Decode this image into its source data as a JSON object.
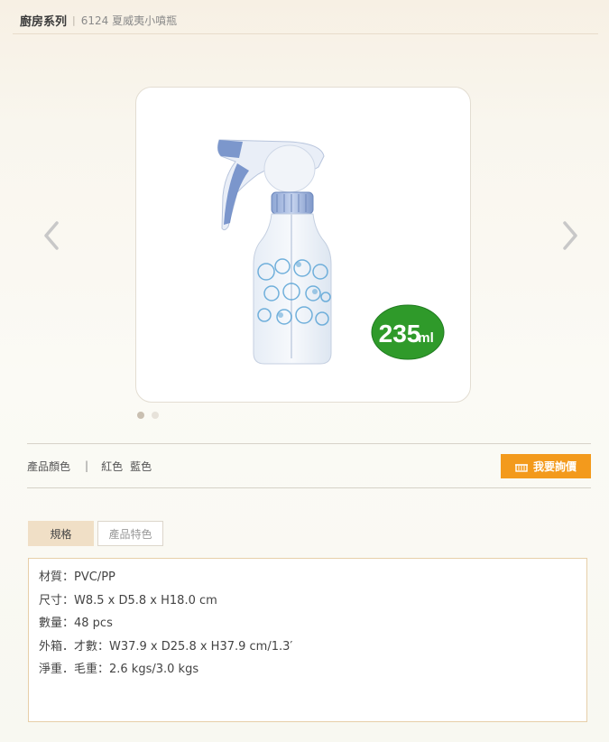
{
  "breadcrumb": {
    "category": "廚房系列",
    "separator": "|",
    "item": "6124 夏威夷小噴瓶"
  },
  "product_image": {
    "volume_badge_number": "235",
    "volume_badge_unit": "ml",
    "badge_color": "#2f9a2a",
    "bottle_accent": "#4f73b5"
  },
  "carousel": {
    "prev_icon": "chevron-left-icon",
    "next_icon": "chevron-right-icon",
    "slide_count": 2,
    "active_slide": 1
  },
  "colors": {
    "label": "產品顏色",
    "separator": "|",
    "options": [
      "紅色",
      "藍色"
    ]
  },
  "inquiry_button": {
    "icon": "basket-icon",
    "label": "我要詢價",
    "color": "#f39a1c"
  },
  "tabs": [
    {
      "label": "規格",
      "active": true
    },
    {
      "label": "產品特色",
      "active": false
    }
  ],
  "specs": [
    "材質：PVC/PP",
    "尺寸：W8.5 x D5.8 x H18.0 cm",
    "數量：48 pcs",
    "外箱．才數：W37.9 x D25.8 x H37.9 cm/1.3′",
    "淨重．毛重：2.6 kgs/3.0 kgs"
  ]
}
